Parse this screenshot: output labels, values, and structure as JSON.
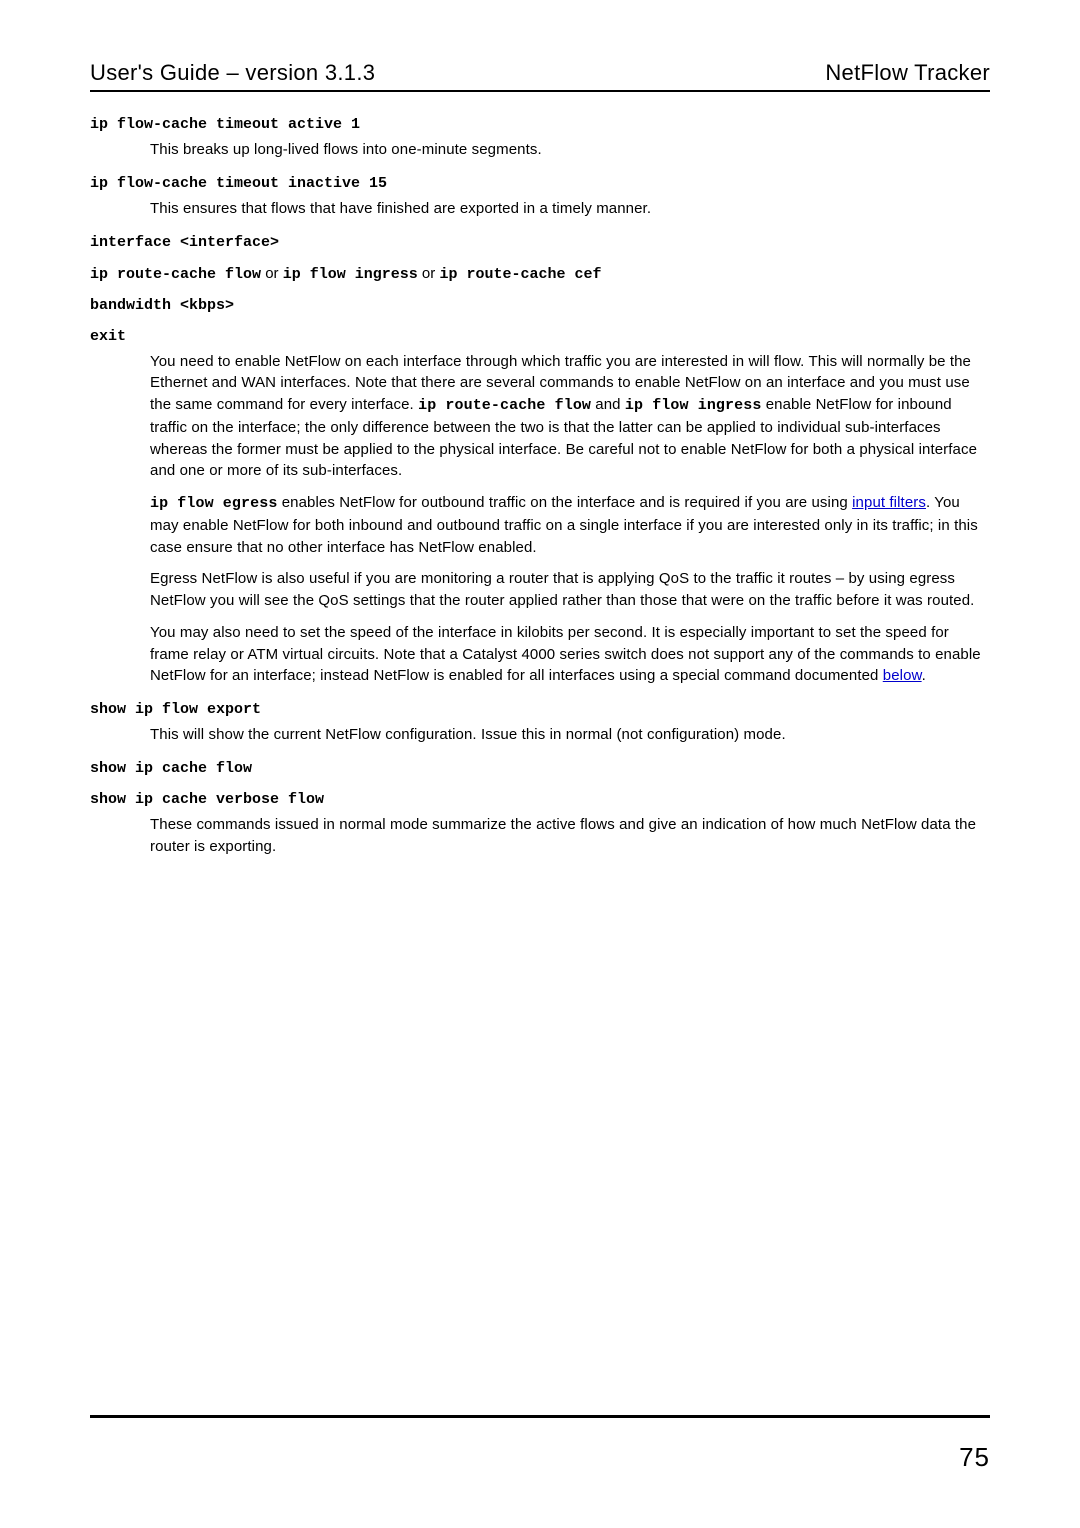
{
  "header": {
    "left": "User's Guide – version 3.1.3",
    "right": "NetFlow Tracker"
  },
  "sections": {
    "cmd1": "ip flow-cache timeout active 1",
    "desc1": "This breaks up long-lived flows into one-minute segments.",
    "cmd2": "ip flow-cache timeout inactive 15",
    "desc2": "This ensures that flows that have finished are exported in a timely manner.",
    "cmd3": "interface <interface>",
    "cmd4a": "ip route-cache flow",
    "or": " or ",
    "cmd4b": "ip flow ingress",
    "cmd4c": "ip route-cache cef",
    "cmd5": "bandwidth <kbps>",
    "cmd6": "exit",
    "para1a": "You need to enable NetFlow on each interface through which traffic you are interested in will flow. This will normally be the Ethernet and WAN interfaces. Note that there are several commands to enable NetFlow on an interface and you must use the same command for every interface. ",
    "para1_code1": "ip route-cache flow",
    "para1b": " and ",
    "para1_code2": "ip flow ingress",
    "para1c": " enable NetFlow for inbound traffic on the interface; the only difference between the two is that the latter can be applied to individual sub-interfaces whereas the former must be applied to the physical interface. Be careful not to enable NetFlow for both a physical interface and one or more of its sub-interfaces.",
    "para2_code": "ip flow egress",
    "para2a": " enables NetFlow for outbound traffic on the interface and is required if you are using ",
    "para2_link": "input filters",
    "para2b": ". You may enable NetFlow for both inbound and outbound traffic on a single interface if you are interested only in its traffic; in this case ensure that no other interface has NetFlow enabled.",
    "para3": "Egress NetFlow is also useful if you are monitoring a router that is applying QoS to the traffic it routes – by using egress NetFlow you will see the QoS settings that the router applied rather than those that were on the traffic before it was routed.",
    "para4a": "You may also need to set the speed of the interface in kilobits per second. It is especially important to set the speed for frame relay or ATM virtual circuits. Note that a Catalyst 4000 series switch does not support any of the commands to enable NetFlow for an interface; instead NetFlow is enabled for all interfaces using a special command documented ",
    "para4_link": "below",
    "para4b": ".",
    "cmd7": "show ip flow export",
    "desc7": "This will show the current NetFlow configuration. Issue this in normal (not configuration) mode.",
    "cmd8": "show ip cache flow",
    "cmd9": "show ip cache verbose flow",
    "desc9": "These commands issued in normal mode summarize the active flows and give an indication of how much NetFlow data the router is exporting."
  },
  "page_number": "75"
}
